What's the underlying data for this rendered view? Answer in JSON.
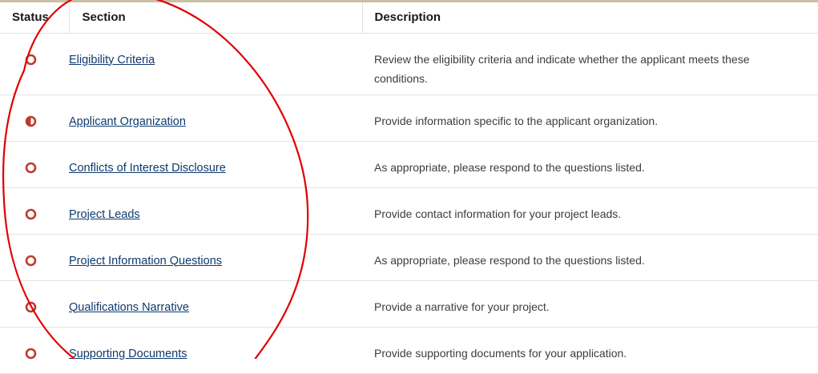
{
  "table": {
    "headers": {
      "status": "Status",
      "section": "Section",
      "description": "Description"
    },
    "rows": [
      {
        "status_icon": "status-empty-circle-icon",
        "section": "Eligibility Criteria",
        "description": "Review the eligibility criteria and indicate whether the applicant meets these conditions."
      },
      {
        "status_icon": "status-half-filled-circle-icon",
        "section": "Applicant Organization",
        "description": "Provide information specific to the applicant organization."
      },
      {
        "status_icon": "status-empty-circle-icon",
        "section": "Conflicts of Interest Disclosure",
        "description": "As appropriate, please respond to the questions listed."
      },
      {
        "status_icon": "status-empty-circle-icon",
        "section": "Project Leads",
        "description": "Provide contact information for your project leads."
      },
      {
        "status_icon": "status-empty-circle-icon",
        "section": "Project Information Questions",
        "description": "As appropriate, please respond to the questions listed."
      },
      {
        "status_icon": "status-empty-circle-icon",
        "section": "Qualifications Narrative",
        "description": "Provide a narrative for your project."
      },
      {
        "status_icon": "status-empty-circle-icon",
        "section": "Supporting Documents",
        "description": "Provide supporting documents for your application."
      }
    ]
  },
  "colors": {
    "status_icon": "#c0392b",
    "link": "#0e3a6e",
    "annotation": "#e00000",
    "divider": "#e3e3e3"
  }
}
